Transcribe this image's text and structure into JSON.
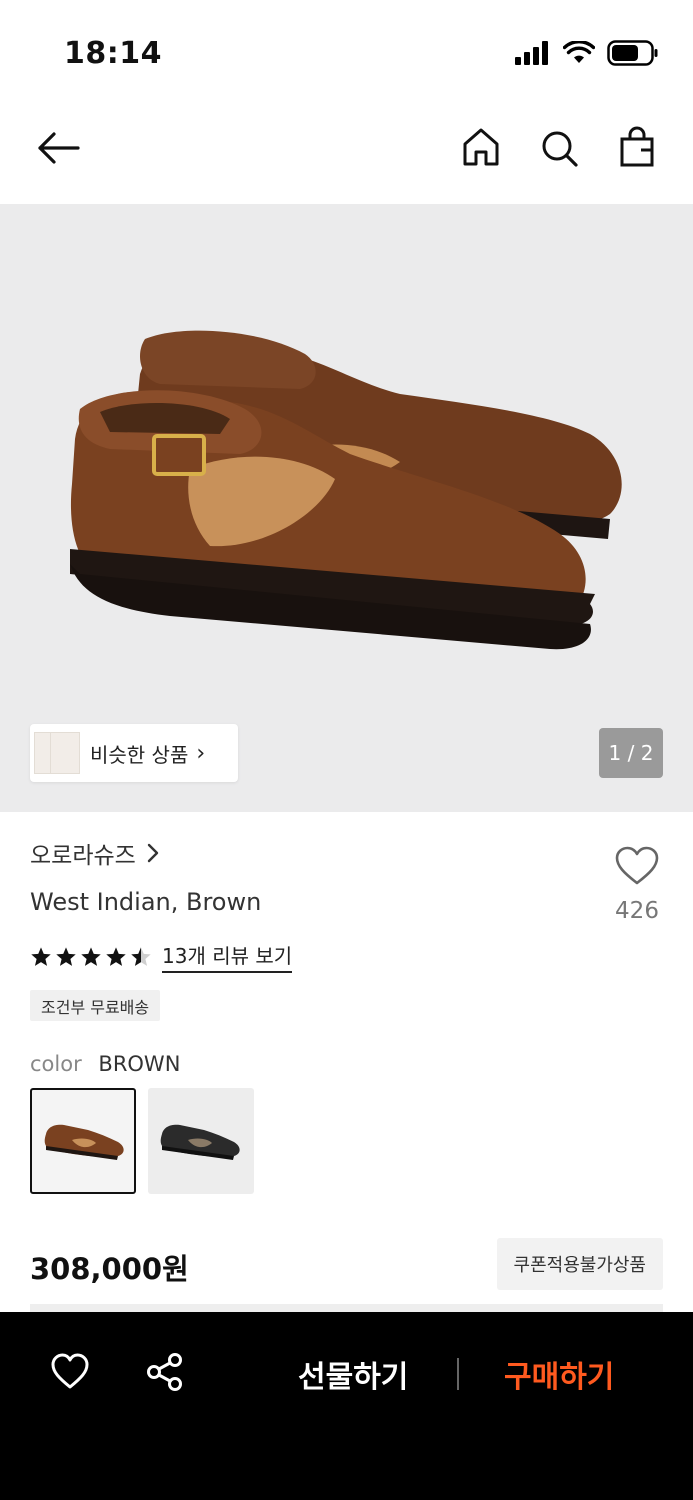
{
  "status_bar": {
    "time": "18:14",
    "icons": [
      "cellular-signal-icon",
      "wifi-icon",
      "battery-icon"
    ]
  },
  "nav": {
    "back_icon": "arrow-left-icon",
    "icons": [
      "home-icon",
      "search-icon",
      "shopping-bag-icon"
    ]
  },
  "hero": {
    "image": "brown-leather-shoes-image",
    "similar_label": "비슷한 상품",
    "page_counter": "1 / 2"
  },
  "product": {
    "brand": "오로라슈즈",
    "name": "West Indian, Brown",
    "like_count": "426",
    "rating": 4.5,
    "review_link": "13개 리뷰 보기",
    "shipping_badge": "조건부 무료배송",
    "color_label": "color",
    "color_value": "BROWN",
    "colors": [
      "brown",
      "black"
    ],
    "price": "308,000원",
    "coupon_badge": "쿠폰적용불가상품"
  },
  "bottom_bar": {
    "gift_label": "선물하기",
    "buy_label": "구매하기",
    "buy_color": "#ff5a1f"
  }
}
